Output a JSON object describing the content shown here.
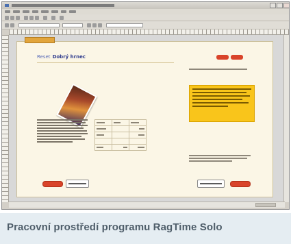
{
  "document": {
    "title_prefix": "Reset",
    "title_main": "Dobrý hrnec"
  },
  "caption": {
    "text": "Pracovní prostředí programu RagTime Solo"
  },
  "colors": {
    "window_chrome": "#d4d0c8",
    "page_background": "#fbf6e6",
    "accent_red": "#d9442a",
    "note_yellow": "#f9c51b",
    "tab_orange": "#e2a53c",
    "caption_background": "#e5edf2",
    "caption_text": "#4f5e6a"
  },
  "icons": {
    "minimize": "minimize-icon",
    "maximize": "maximize-icon",
    "close": "close-icon"
  }
}
